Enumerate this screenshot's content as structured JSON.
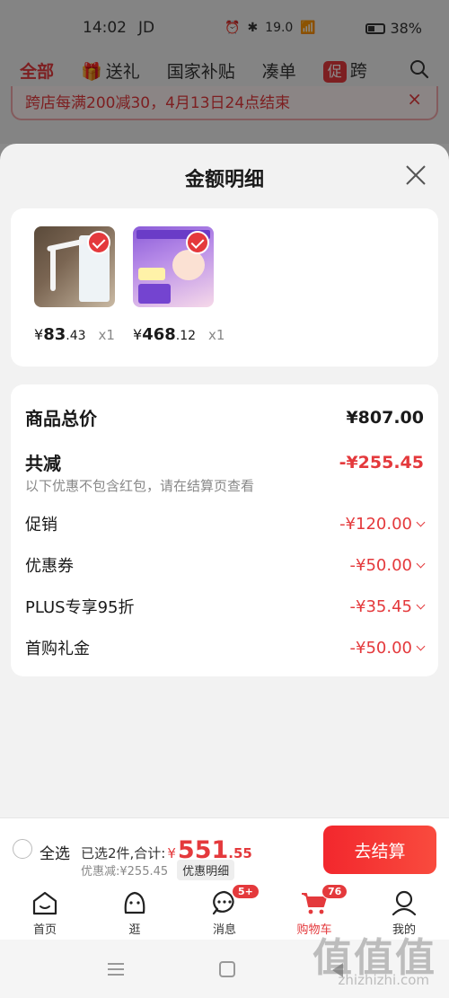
{
  "status_bar": {
    "time": "14:02",
    "carrier": "JD",
    "net_speed": "19.0",
    "net_unit": "KB/S",
    "battery": "38%"
  },
  "category_tabs": [
    {
      "label": "全部",
      "active": true
    },
    {
      "label": "送礼"
    },
    {
      "label": "国家补贴"
    },
    {
      "label": "凑单"
    },
    {
      "label": "跨"
    }
  ],
  "promo_badge": "促",
  "notice": {
    "text": "跨店每满200减30，4月13日24点结束",
    "close": "×"
  },
  "sheet": {
    "title": "金额明细"
  },
  "products": [
    {
      "price_symbol": "¥",
      "price_int": "83",
      "price_dec": ".43",
      "qty": "x1",
      "image": "desk-lamp"
    },
    {
      "price_symbol": "¥",
      "price_int": "468",
      "price_dec": ".12",
      "qty": "x1",
      "image": "milk-powder"
    }
  ],
  "summary": {
    "total_label": "商品总价",
    "total_value": "¥807.00",
    "reduce_label": "共减",
    "reduce_value": "-¥255.45",
    "note": "以下优惠不包含红包，请在结算页查看",
    "items": [
      {
        "label": "促销",
        "value": "-¥120.00"
      },
      {
        "label": "优惠券",
        "value": "-¥50.00"
      },
      {
        "label": "PLUS专享95折",
        "value": "-¥35.45"
      },
      {
        "label": "首购礼金",
        "value": "-¥50.00"
      }
    ]
  },
  "checkout": {
    "select_all": "全选",
    "selected_text": "已选2件,合计:",
    "total_symbol": "¥",
    "total_int": "551",
    "total_dec": ".55",
    "discount": "优惠减:¥255.45",
    "detail_button": "优惠明细",
    "button": "去结算"
  },
  "tabbar": [
    {
      "label": "首页",
      "icon": "home-icon"
    },
    {
      "label": "逛",
      "icon": "stroll-icon"
    },
    {
      "label": "消息",
      "icon": "message-icon",
      "badge": "5+"
    },
    {
      "label": "购物车",
      "icon": "cart-icon",
      "badge": "76",
      "active": true
    },
    {
      "label": "我的",
      "icon": "profile-icon"
    }
  ],
  "watermark": {
    "main": "值值值",
    "sub": "zhizhizhi.com"
  },
  "colors": {
    "accent": "#e4393c",
    "background": "#f2f2f2"
  }
}
